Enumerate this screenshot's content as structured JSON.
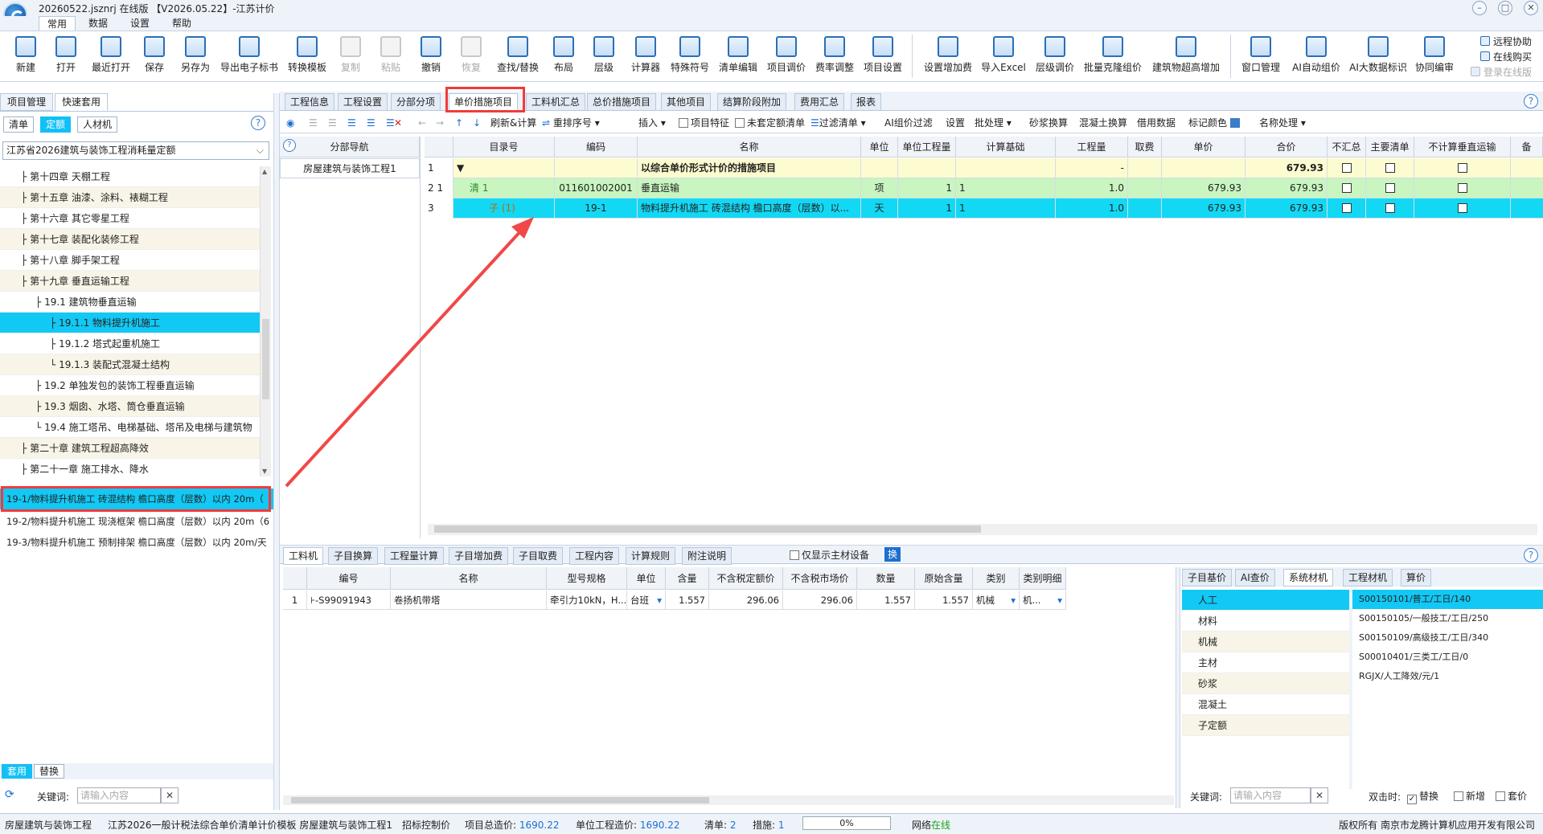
{
  "window": {
    "title": "20260522.jsznrj 在线版 【V2026.05.22】-江苏计价"
  },
  "menu": {
    "tabs": [
      "常用",
      "数据",
      "设置",
      "帮助"
    ]
  },
  "ribbon": {
    "buttons": [
      "新建",
      "打开",
      "最近打开",
      "保存",
      "另存为",
      "导出电子标书",
      "转换模板",
      "复制",
      "粘贴",
      "撤销",
      "恢复",
      "查找/替换",
      "布局",
      "层级",
      "计算器",
      "特殊符号",
      "清单编辑",
      "项目调价",
      "费率调整",
      "项目设置",
      "设置增加费",
      "导入Excel",
      "层级调价",
      "批量克隆组价",
      "建筑物超高增加",
      "窗口管理",
      "AI自动组价",
      "AI大数据标识",
      "协同编审"
    ],
    "side": [
      "远程协助",
      "在线购买",
      "登录在线版"
    ]
  },
  "left_panel": {
    "tabs": [
      "项目管理",
      "快速套用"
    ],
    "filters": [
      "清单",
      "定额",
      "人材机"
    ],
    "help": "?",
    "quota_library": "江苏省2026建筑与装饰工程消耗量定额",
    "tree": [
      "第十四章 天棚工程",
      "第十五章 油漆、涂料、裱糊工程",
      "第十六章 其它零星工程",
      "第十七章 装配化装修工程",
      "第十八章 脚手架工程",
      "第十九章 垂直运输工程",
      "19.1 建筑物垂直运输",
      "19.1.1 物料提升机施工",
      "19.1.2 塔式起重机施工",
      "19.1.3 装配式混凝土结构",
      "19.2 单独发包的装饰工程垂直运输",
      "19.3 烟囱、水塔、筒仓垂直运输",
      "19.4 施工塔吊、电梯基础、塔吊及电梯与建筑物",
      "第二十章 建筑工程超高降效",
      "第二十一章 施工排水、降水"
    ],
    "list": [
      "19-1/物料提升机施工 砖混结构 檐口高度（层数）以内 20m（",
      "19-2/物料提升机施工 现浇框架 檐口高度（层数）以内 20m（6",
      "19-3/物料提升机施工 预制排架 檐口高度（层数）以内 20m/天"
    ],
    "bottom_tabs": [
      "套用",
      "替换"
    ],
    "keyword_label": "关键词:",
    "keyword_placeholder": "请输入内容",
    "clear": "✕"
  },
  "page_tabs": [
    "工程信息",
    "工程设置",
    "分部分项",
    "单价措施项目",
    "工料机汇总",
    "总价措施项目",
    "其他项目",
    "结算阶段附加",
    "费用汇总",
    "报表"
  ],
  "toolbar": {
    "refresh": "刷新&计算",
    "reorder": "重排序号",
    "insert": "插入",
    "project_feature": "项目特征",
    "unset_quota": "未套定额清单",
    "filter_list": "过滤清单",
    "ai_filter": "AI组价过滤",
    "settings": "设置",
    "batch": "批处理",
    "mortar": "砂浆换算",
    "concrete": "混凝土换算",
    "borrow": "借用数据",
    "mark_color": "标记颜色",
    "name_proc": "名称处理"
  },
  "section_nav": {
    "header": "分部导航",
    "item": "房屋建筑与装饰工程1"
  },
  "grid": {
    "headers": [
      "目录号",
      "编码",
      "名称",
      "单位",
      "单位工程量",
      "计算基础",
      "工程量",
      "取费",
      "单价",
      "合价",
      "不汇总",
      "主要清单",
      "不计算垂直运输",
      "备"
    ],
    "rows": [
      {
        "no": "1",
        "idx": "",
        "code": "",
        "name": "以综合单价形式计价的措施项目",
        "unit": "",
        "uqty": "",
        "base": "",
        "qty": "-",
        "fee": "",
        "price": "",
        "total": "679.93"
      },
      {
        "no": "2 1",
        "idx": "清  1",
        "code": "011601002001",
        "name": "垂直运输",
        "unit": "项",
        "uqty": "1",
        "base": "1",
        "qty": "1.0",
        "fee": "",
        "price": "679.93",
        "total": "679.93"
      },
      {
        "no": "3",
        "idx": "子  (1)",
        "code": "19-1",
        "name": "物料提升机施工 砖混结构 檐口高度（层数）以...",
        "unit": "天",
        "uqty": "1",
        "base": "1",
        "qty": "1.0",
        "fee": "",
        "price": "679.93",
        "total": "679.93"
      }
    ]
  },
  "bottom_tabs": [
    "工料机",
    "子目换算",
    "工程量计算",
    "子目增加费",
    "子目取费",
    "工程内容",
    "计算规则",
    "附注说明"
  ],
  "only_main_material": "仅显示主材设备",
  "swap_btn": "换",
  "bottom_grid": {
    "headers": [
      "编号",
      "名称",
      "型号规格",
      "单位",
      "含量",
      "不含税定额价",
      "不含税市场价",
      "数量",
      "原始含量",
      "类别",
      "类别明细"
    ],
    "row": {
      "n": "1",
      "code": "S99091943",
      "name": "卷扬机带塔",
      "spec": "牵引力10kN，H...",
      "unit": "台班",
      "content": "1.557",
      "quota_price": "296.06",
      "market_price": "296.06",
      "amount": "1.557",
      "orig_content": "1.557",
      "type": "机械",
      "detail": "机..."
    }
  },
  "right_tabs": [
    "子目基价",
    "AI查价",
    "系统材机",
    "工程材机",
    "算价"
  ],
  "categories": [
    "人工",
    "材料",
    "机械",
    "主材",
    "砂浆",
    "混凝土",
    "子定额"
  ],
  "resources": [
    "S00150101/普工/工日/140",
    "S00150105/一般技工/工日/250",
    "S00150109/高级技工/工日/340",
    "S00010401/三类工/工日/0",
    "RGJX/人工降效/元/1"
  ],
  "right_bottom": {
    "keyword": "关键词:",
    "placeholder": "请输入内容",
    "dbl_label": "双击时:",
    "opts": [
      "替换",
      "新增",
      "套价"
    ]
  },
  "status": {
    "project": "房屋建筑与装饰工程",
    "template": "江苏2026一般计税法综合单价清单计价模板 房屋建筑与装饰工程1",
    "control_label": "招标控制价",
    "total_label": "项目总造价:",
    "total": "1690.22",
    "unit_label": "单位工程造价:",
    "unit_total": "1690.22",
    "list_label": "清单:",
    "list_count": "2",
    "measure_label": "措施:",
    "measure_count": "1",
    "progress": "0%",
    "net_label": "网络",
    "net_state": "在线",
    "copyright": "版权所有 南京市龙腾计算机应用开发有限公司"
  }
}
